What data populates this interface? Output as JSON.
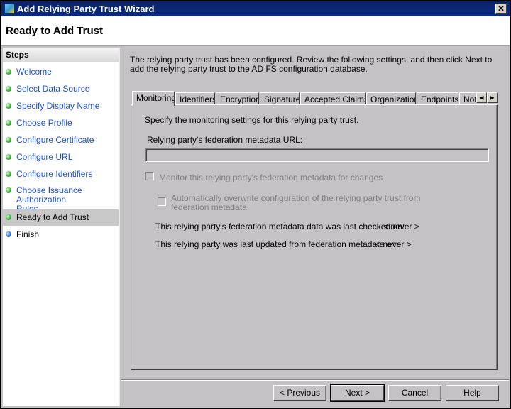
{
  "window": {
    "title": "Add Relying Party Trust Wizard",
    "close": "✕"
  },
  "header": {
    "title": "Ready to Add Trust"
  },
  "steps": {
    "heading": "Steps",
    "items": [
      {
        "label": "Welcome",
        "state": "done"
      },
      {
        "label": "Select Data Source",
        "state": "done"
      },
      {
        "label": "Specify Display Name",
        "state": "done"
      },
      {
        "label": "Choose Profile",
        "state": "done"
      },
      {
        "label": "Configure Certificate",
        "state": "done"
      },
      {
        "label": "Configure URL",
        "state": "done"
      },
      {
        "label": "Configure Identifiers",
        "state": "done"
      },
      {
        "label": "Choose Issuance Authorization Rules",
        "state": "done"
      },
      {
        "label": "Ready to Add Trust",
        "state": "selected"
      },
      {
        "label": "Finish",
        "state": "pending"
      }
    ]
  },
  "main": {
    "intro": "The relying party trust has been configured. Review the following settings, and then click Next to add the relying party trust to the AD FS configuration database.",
    "tabs": [
      "Monitoring",
      "Identifiers",
      "Encryption",
      "Signature",
      "Accepted Claims",
      "Organization",
      "Endpoints",
      "Not"
    ],
    "active_tab": "Monitoring",
    "monitoring": {
      "description": "Specify the monitoring settings for this relying party trust.",
      "url_label": "Relying party's federation metadata URL:",
      "url_value": "",
      "monitor_checkbox": "Monitor this relying party's federation metadata for changes",
      "monitor_checked": false,
      "overwrite_checkbox_line1": "Automatically overwrite configuration of the relying party trust from",
      "overwrite_checkbox_line2": "federation metadata",
      "overwrite_checked": false,
      "last_checked_label": "This relying party's federation metadata data was last checked on:",
      "last_checked_value": "< never >",
      "last_updated_label": "This relying party was last updated from federation metadata on:",
      "last_updated_value": "< never >"
    }
  },
  "buttons": {
    "previous": "< Previous",
    "next": "Next >",
    "cancel": "Cancel",
    "help": "Help"
  },
  "colors": {
    "titlebar": "#0a246a",
    "link": "#1a4fd6",
    "step_done": "#33aa33",
    "step_pending": "#2266cc"
  }
}
